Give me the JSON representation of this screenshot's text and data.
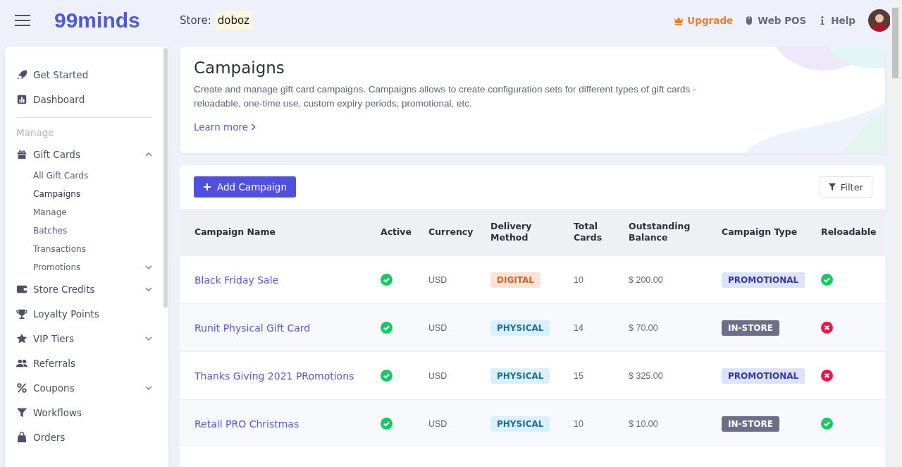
{
  "topbar": {
    "logo": "99minds",
    "store_label": "Store:",
    "store_name": "doboz",
    "links": [
      {
        "label": "Upgrade",
        "kind": "upgrade"
      },
      {
        "label": "Web POS",
        "kind": "pos"
      },
      {
        "label": "Help",
        "kind": "help"
      }
    ]
  },
  "sidebar": {
    "items": [
      {
        "label": "Get Started"
      },
      {
        "label": "Dashboard"
      },
      {
        "kind": "divider"
      },
      {
        "kind": "heading",
        "label": "Manage"
      },
      {
        "label": "Gift Cards",
        "expanded": true,
        "children": [
          {
            "label": "All Gift Cards",
            "selected": false
          },
          {
            "label": "Campaigns",
            "selected": true
          },
          {
            "label": "Manage",
            "selected": false
          },
          {
            "label": "Batches",
            "selected": false
          },
          {
            "label": "Transactions",
            "selected": false
          },
          {
            "label": "Promotions",
            "selected": false,
            "expanded": false
          }
        ]
      },
      {
        "label": "Store Credits",
        "expanded": false
      },
      {
        "label": "Loyalty Points"
      },
      {
        "label": "VIP Tiers",
        "expanded": false
      },
      {
        "label": "Referrals"
      },
      {
        "label": "Coupons",
        "expanded": false
      },
      {
        "label": "Workflows"
      },
      {
        "label": "Orders"
      }
    ]
  },
  "header": {
    "title": "Campaigns",
    "description": "Create and manage gift card campaigns. Campaigns allows to create configuration sets for different types of gift cards - reloadable, one-time use, custom expiry periods, promotional, etc.",
    "link": "Learn more"
  },
  "toolbar": {
    "primary_button": "Add Campaign",
    "filter_button": "Filter"
  },
  "table": {
    "columns": [
      "Campaign Name",
      "Active",
      "Currency",
      "Delivery Method",
      "Total Cards",
      "Outstanding Balance",
      "Campaign Type",
      "Reloadable"
    ],
    "rows": [
      {
        "name": "Black Friday Sale",
        "active": true,
        "currency": "USD",
        "delivery": {
          "label": "DIGITAL",
          "kind": "digital"
        },
        "total": "10",
        "balance": "$ 200.00",
        "type": {
          "label": "PROMOTIONAL",
          "kind": "promotional"
        },
        "reloadable": true
      },
      {
        "name": "Runit Physical Gift Card",
        "active": true,
        "currency": "USD",
        "delivery": {
          "label": "PHYSICAL",
          "kind": "physical"
        },
        "total": "14",
        "balance": "$ 70.00",
        "type": {
          "label": "IN-STORE",
          "kind": "instore"
        },
        "reloadable": false
      },
      {
        "name": "Thanks Giving 2021 PRomotions",
        "active": true,
        "currency": "USD",
        "delivery": {
          "label": "PHYSICAL",
          "kind": "physical"
        },
        "total": "15",
        "balance": "$ 325.00",
        "type": {
          "label": "PROMOTIONAL",
          "kind": "promotional"
        },
        "reloadable": false
      },
      {
        "name": "Retail PRO Christmas",
        "active": true,
        "currency": "USD",
        "delivery": {
          "label": "PHYSICAL",
          "kind": "physical"
        },
        "total": "10",
        "balance": "$ 10.00",
        "type": {
          "label": "IN-STORE",
          "kind": "instore"
        },
        "reloadable": true
      }
    ]
  }
}
